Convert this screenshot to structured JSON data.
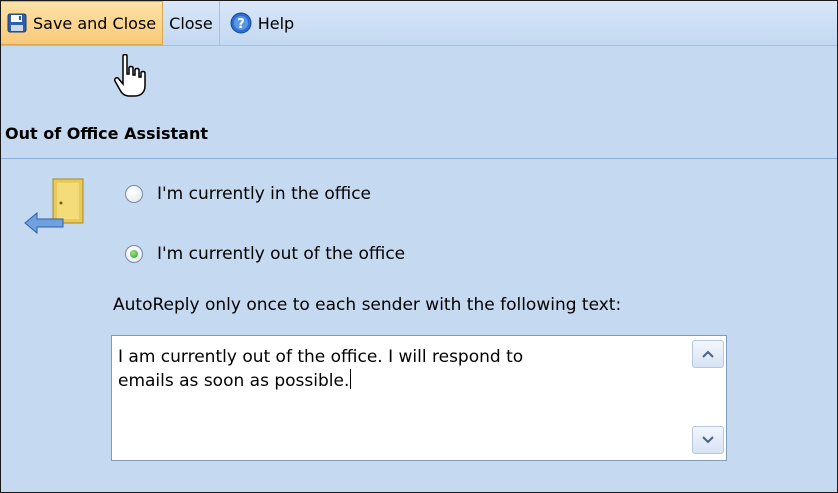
{
  "toolbar": {
    "save_close_label": "Save and Close",
    "close_label": "Close",
    "help_label": "Help"
  },
  "section": {
    "title": "Out of Office Assistant"
  },
  "status_options": [
    {
      "label": "I'm currently in the office",
      "selected": false
    },
    {
      "label": "I'm currently out of the office",
      "selected": true
    }
  ],
  "autoreply": {
    "label": "AutoReply only once to each sender with the following text:",
    "message_line1": "I am currently out of the office.  I will respond to",
    "message_line2": "emails as soon as possible."
  },
  "icons": {
    "save": "floppy-disk-icon",
    "help": "help-icon",
    "out_of_office": "door-arrow-icon",
    "cursor": "hand-pointer-icon"
  },
  "colors": {
    "background": "#c5d9f1",
    "toolbar_highlight": "#f9c978",
    "divider": "#8fb0d9"
  }
}
